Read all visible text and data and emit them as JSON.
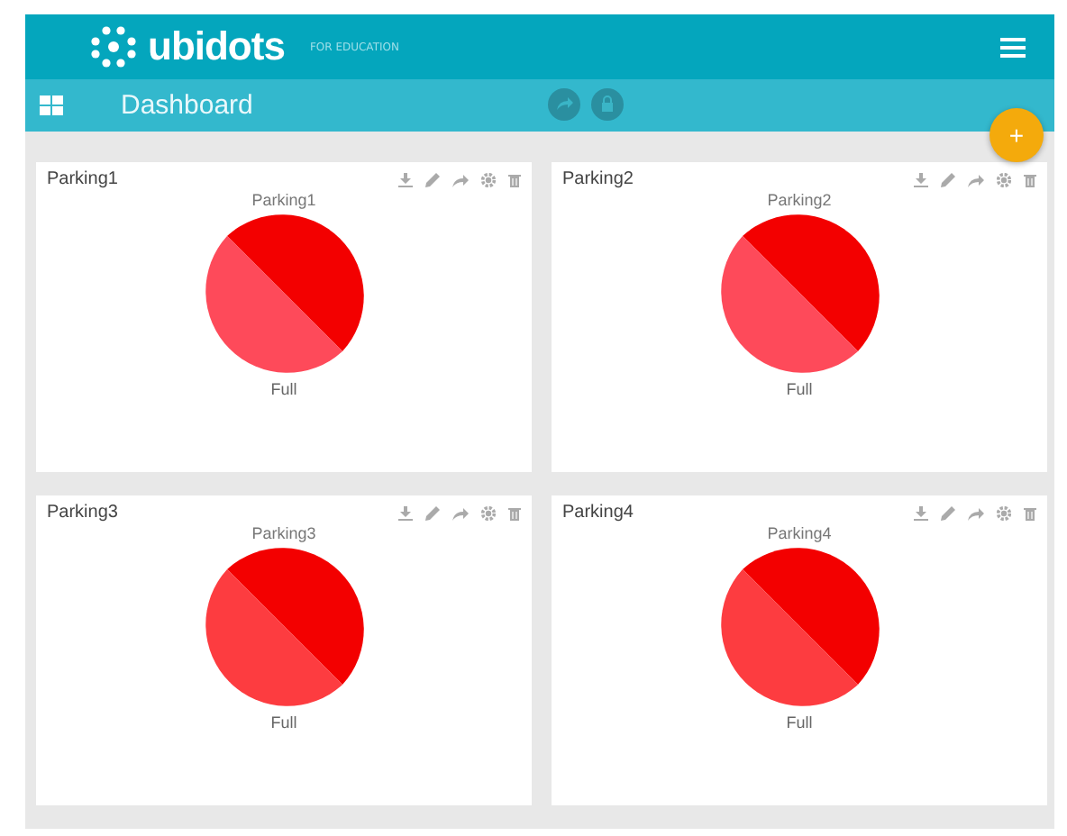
{
  "header": {
    "brand": "ubidots",
    "tagline": "FOR EDUCATION"
  },
  "toolbar": {
    "title": "Dashboard",
    "add_button": "+"
  },
  "widgets": [
    {
      "title": "Parking1",
      "chart_title": "Parking1",
      "label": "Full"
    },
    {
      "title": "Parking2",
      "chart_title": "Parking2",
      "label": "Full"
    },
    {
      "title": "Parking3",
      "chart_title": "Parking3",
      "label": "Full"
    },
    {
      "title": "Parking4",
      "chart_title": "Parking4",
      "label": "Full"
    }
  ]
}
